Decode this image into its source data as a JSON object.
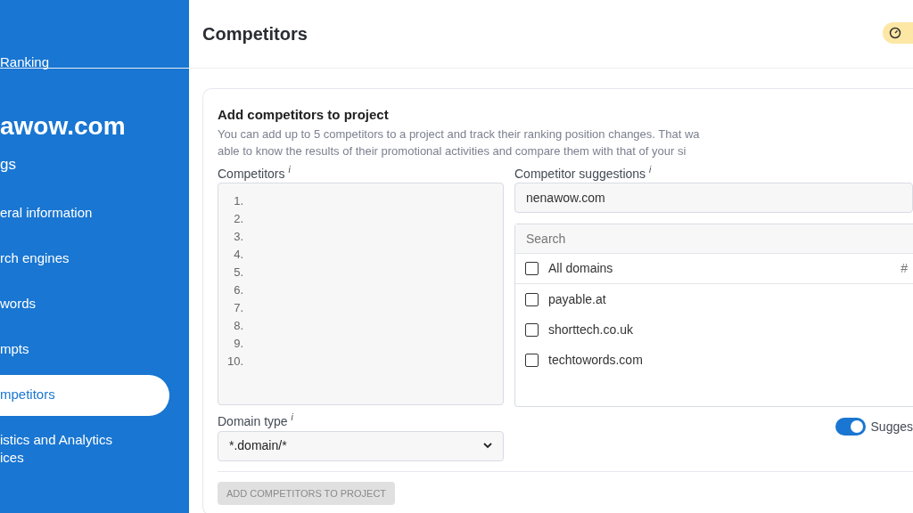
{
  "sidebar": {
    "app_title": "Ranking",
    "project": "awow.com",
    "section": "gs",
    "items": [
      {
        "label": "eral information",
        "selected": false
      },
      {
        "label": "rch engines",
        "selected": false
      },
      {
        "label": "words",
        "selected": false
      },
      {
        "label": "mpts",
        "selected": false
      },
      {
        "label": "mpetitors",
        "selected": true
      },
      {
        "label": "istics and Analytics\nices",
        "selected": false
      }
    ]
  },
  "header": {
    "title": "Competitors"
  },
  "card": {
    "title": "Add competitors to project",
    "description_lines": [
      "You can add up to 5 competitors to a project and track their ranking position changes. That wa",
      "able to know the results of their promotional activities and compare them with that of your si"
    ],
    "competitors": {
      "label": "Competitors",
      "hint": "i",
      "line_numbers": [
        "1.",
        "2.",
        "3.",
        "4.",
        "5.",
        "6.",
        "7.",
        "8.",
        "9.",
        "10."
      ]
    },
    "suggestions": {
      "label": "Competitor suggestions",
      "hint": "i",
      "domain": "nenawow.com",
      "search_placeholder": "Search",
      "all": {
        "label": "All domains",
        "checked": false,
        "column_2": "#"
      },
      "domains": [
        {
          "name": "payable.at",
          "checked": false
        },
        {
          "name": "shorttech.co.uk",
          "checked": false
        },
        {
          "name": "techtowords.com",
          "checked": false
        }
      ]
    },
    "domain_type": {
      "label": "Domain type",
      "hint": "i",
      "value": "*.domain/*"
    },
    "suggest_toggle": {
      "label": "Sugges",
      "on": true
    },
    "submit": {
      "label": "ADD COMPETITORS TO PROJECT",
      "disabled": true
    }
  }
}
